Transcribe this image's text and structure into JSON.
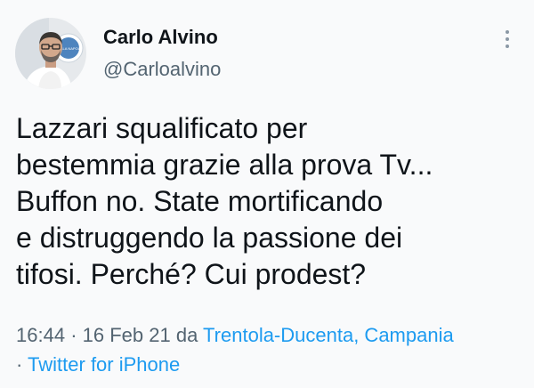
{
  "author": {
    "display_name": "Carlo Alvino",
    "handle": "@Carloalvino",
    "avatar_badge_text": "BELLA NAPOLI",
    "more_icon": "more-vertical-icon"
  },
  "tweet": {
    "text_lines": [
      "Lazzari squalificato per",
      "bestemmia grazie alla prova Tv...",
      "Buffon no. State mortificando",
      "e distruggendo la passione dei",
      "tifosi. Perché? Cui prodest?"
    ]
  },
  "meta": {
    "time": "16:44",
    "separator": "·",
    "date": "16 Feb 21",
    "from_word": "da",
    "location": "Trentola-Ducenta, Campania",
    "client": "Twitter for iPhone"
  },
  "colors": {
    "background": "#f9fafb",
    "text": "#0f1419",
    "secondary": "#536471",
    "link": "#1d9bf0"
  }
}
